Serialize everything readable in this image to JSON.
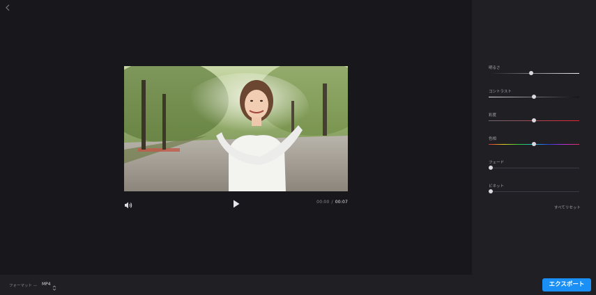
{
  "header": {
    "back_icon": "chevron-left-icon"
  },
  "player": {
    "current_time": "00:00",
    "separator": "/",
    "total_time": "00:07",
    "volume_icon": "volume-icon",
    "play_icon": "play-icon"
  },
  "adjustments": [
    {
      "id": "brightness",
      "label": "明るさ",
      "value": 0.47,
      "track": "brightness"
    },
    {
      "id": "contrast",
      "label": "コントラスト",
      "value": 0.5,
      "track": "contrast"
    },
    {
      "id": "saturation",
      "label": "彩度",
      "value": 0.5,
      "track": "saturation"
    },
    {
      "id": "hue",
      "label": "色相",
      "value": 0.5,
      "track": "hue"
    },
    {
      "id": "fade",
      "label": "フェード",
      "value": 0.0,
      "track": "plain"
    },
    {
      "id": "vignette",
      "label": "ビネット",
      "value": 0.0,
      "track": "plain"
    }
  ],
  "reset_label": "すべてリセット",
  "footer": {
    "format_label": "フォーマット —",
    "format_value": "MP4",
    "export_label": "エクスポート"
  },
  "colors": {
    "accent": "#1a8ff5",
    "background": "#18181c",
    "panel": "#202024"
  }
}
